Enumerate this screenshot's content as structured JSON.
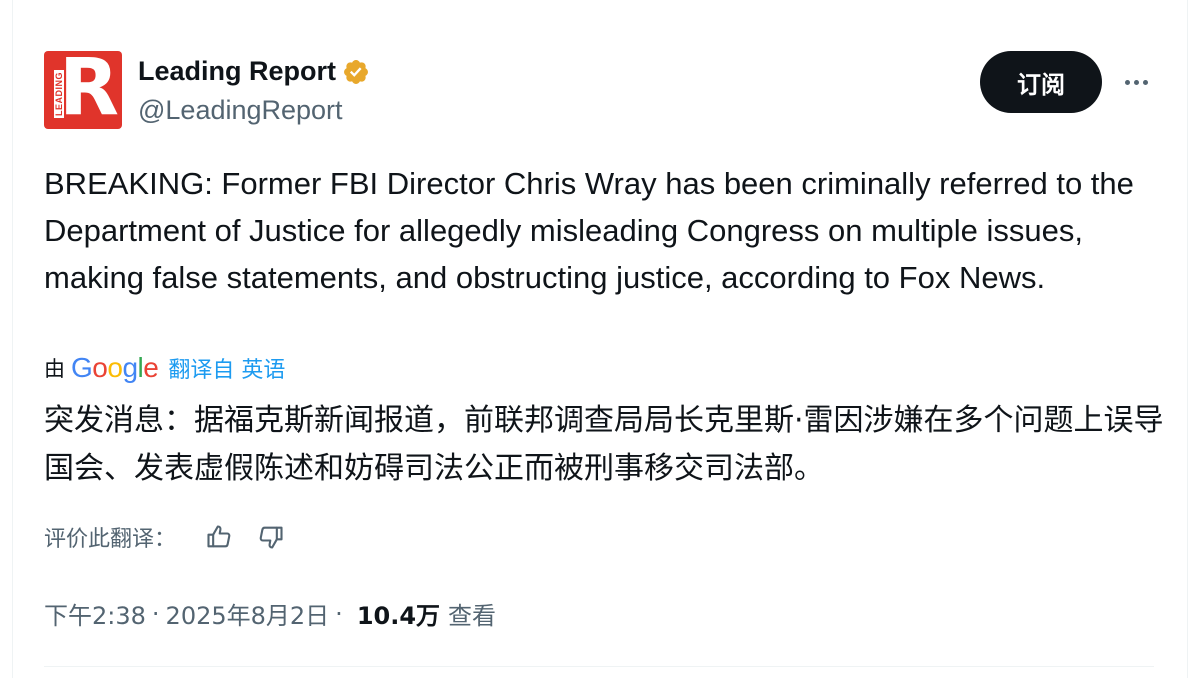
{
  "author": {
    "display_name": "Leading Report",
    "handle": "@LeadingReport",
    "avatar_letter": "R",
    "avatar_vertical_text": "LEADING",
    "brand_color": "#e0342b",
    "verified_color": "#e8a82c"
  },
  "actions": {
    "subscribe_label": "订阅"
  },
  "tweet": {
    "text": "BREAKING: Former FBI Director Chris Wray has been criminally referred to the Department of Justice for allegedly misleading Congress on multiple issues, making false statements, and obstructing justice, according to Fox News.",
    "translation_by": "由",
    "translation_provider": "Google",
    "translated_from": "翻译自 英语",
    "translated_text": "突发消息：据福克斯新闻报道，前联邦调查局局长克里斯·雷因涉嫌在多个问题上误导国会、发表虚假陈述和妨碍司法公正而被刑事移交司法部。",
    "rate_label": "评价此翻译：",
    "time": "下午2:38",
    "date": "2025年8月2日",
    "views_count": "10.4万",
    "views_label": "查看"
  },
  "colors": {
    "link": "#1d9bf0",
    "secondary_text": "#536471",
    "primary_text": "#0f1419"
  }
}
